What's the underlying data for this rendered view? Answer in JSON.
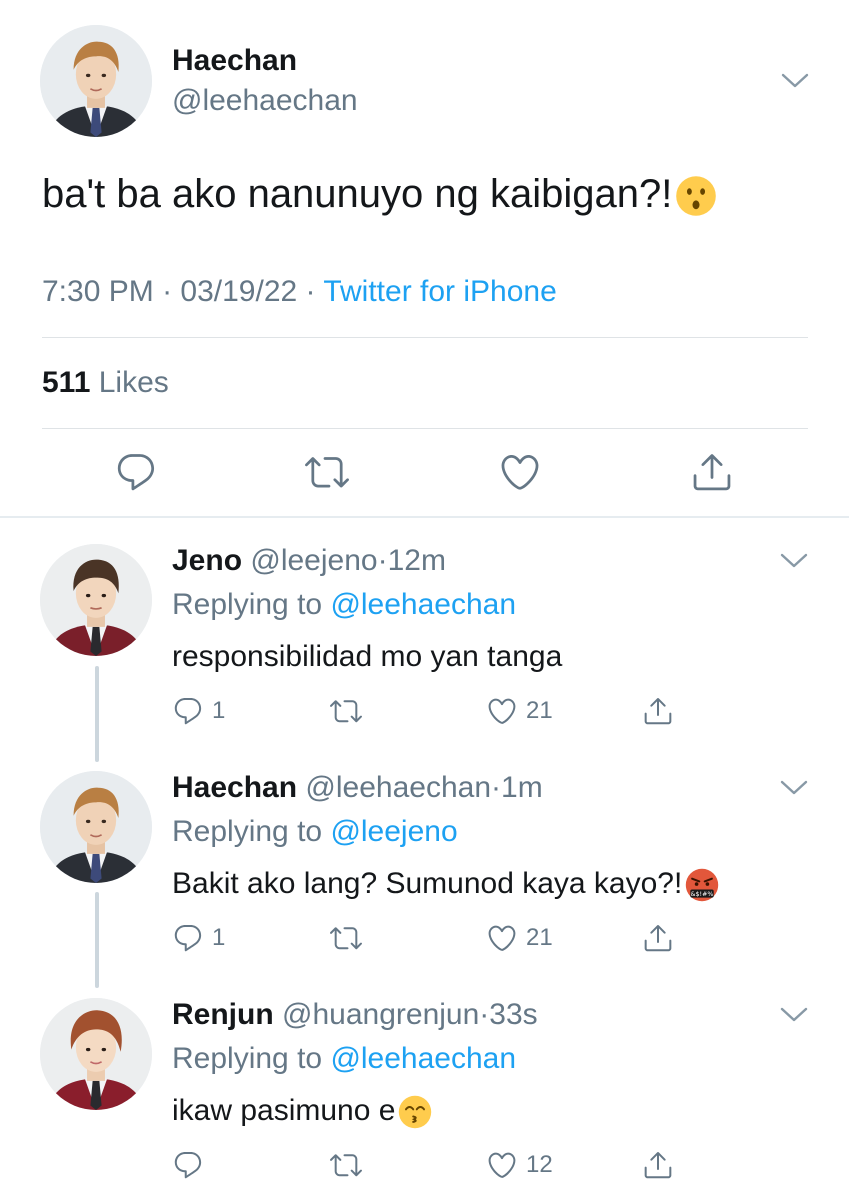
{
  "main_tweet": {
    "name": "Haechan",
    "handle": "@leehaechan",
    "text": "ba't ba ako nanunuyo ng kaibigan?!",
    "emoji": "hushed-face",
    "time": "7:30 PM",
    "separator": "·",
    "date": "03/19/22",
    "source": "Twitter for iPhone",
    "likes_count": "511",
    "likes_label": "Likes"
  },
  "replies": [
    {
      "name": "Jeno",
      "handle": "@leejeno",
      "time": "12m",
      "replying_prefix": "Replying to",
      "replying_to": "@leehaechan",
      "text": "responsibilidad mo yan tanga",
      "reply_count": "1",
      "like_count": "21"
    },
    {
      "name": "Haechan",
      "handle": "@leehaechan",
      "time": "1m",
      "replying_prefix": "Replying to",
      "replying_to": "@leejeno",
      "text": "Bakit ako lang? Sumunod kaya kayo?!",
      "emoji": "face-with-symbols-on-mouth",
      "reply_count": "1",
      "like_count": "21"
    },
    {
      "name": "Renjun",
      "handle": "@huangrenjun",
      "time": "33s",
      "replying_prefix": "Replying to",
      "replying_to": "@leehaechan",
      "text": "ikaw pasimuno e",
      "emoji": "kissing-face-smiling-eyes",
      "reply_count": "",
      "like_count": "12"
    }
  ],
  "colors": {
    "text": "#14171a",
    "secondary": "#657786",
    "link": "#1da1f2",
    "divider": "#dfe3e6"
  }
}
